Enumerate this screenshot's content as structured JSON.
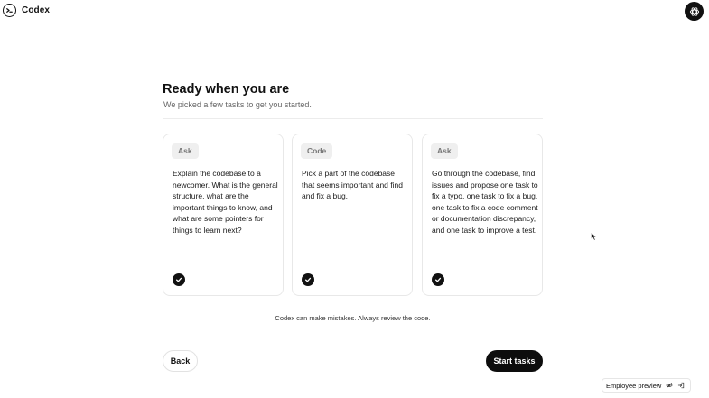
{
  "app": {
    "name": "Codex",
    "brand_icon": "terminal-circle-icon",
    "avatar_icon": "openai-logo-icon"
  },
  "onboarding": {
    "title": "Ready when you are",
    "subtitle": "We picked a few tasks to get you started.",
    "cards": [
      {
        "tag": "Ask",
        "text": "Explain the codebase to a newcomer. What is the general structure, what are the important things to know, and what are some pointers for things to learn next?",
        "selected": true
      },
      {
        "tag": "Code",
        "text": "Pick a part of the codebase that seems important and find and fix a bug.",
        "selected": true
      },
      {
        "tag": "Ask",
        "text": "Go through the codebase, find issues and propose one task to fix a typo, one task to fix a bug, one task to fix a code comment or documentation discrepancy, and one task to improve a test.",
        "selected": true
      }
    ],
    "disclaimer": "Codex can make mistakes. Always review the code.",
    "back_label": "Back",
    "start_label": "Start tasks"
  },
  "footer": {
    "badge_label": "Employee preview",
    "badge_icons": [
      "eye-off-icon",
      "sign-in-icon"
    ]
  },
  "colors": {
    "primary": "#0d0d0d",
    "tag_bg": "#efefef",
    "card_border": "#e8e8e8"
  }
}
